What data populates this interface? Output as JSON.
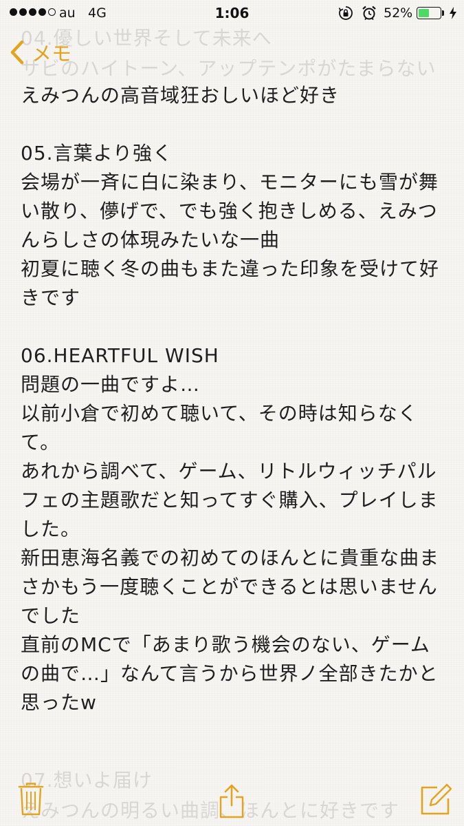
{
  "status_bar": {
    "carrier": "au",
    "network": "4G",
    "time": "1:06",
    "battery_percent": "52%",
    "battery_level": 0.52,
    "signal_bars_filled": 4,
    "signal_bars_total": 5,
    "icons": [
      "rotation-lock-icon",
      "alarm-icon",
      "charging-bolt-icon"
    ]
  },
  "nav": {
    "back_label": "メモ"
  },
  "ghost_lines": [
    "04.優しい世界そして未来へ",
    "サビのハイトーン、アップテンポがたまらない",
    "07.想いよ届け",
    "えみつんの明るい曲調、ほんとに好きです"
  ],
  "note": {
    "lines": [
      "えみつんの高音域狂おしいほど好き",
      "",
      "05.言葉より強く",
      "会場が一斉に白に染まり、モニターにも雪が舞",
      "い散り、儚げで、でも強く抱きしめる、えみつ",
      "んらしさの体現みたいな一曲",
      "初夏に聴く冬の曲もまた違った印象を受けて好",
      "きです",
      "",
      "06.HEARTFUL WISH",
      "問題の一曲ですよ…",
      "以前小倉で初めて聴いて、その時は知らなく",
      "て。",
      "あれから調べて、ゲーム、リトルウィッチパル",
      "フェの主題歌だと知ってすぐ購入、プレイしま",
      "した。",
      "新田恵海名義での初めてのほんとに貴重な曲ま",
      "さかもう一度聴くことができるとは思いません",
      "でした",
      "直前のMCで「あまり歌う機会のない、ゲーム",
      "の曲で…」なんて言うから世界ノ全部きたかと",
      "思ったw"
    ]
  },
  "toolbar": {
    "items": [
      "trash-icon",
      "share-icon",
      "compose-icon"
    ]
  },
  "colors": {
    "accent": "#e2a41e",
    "battery_fill": "#4cd964",
    "background": "#f6f5f2",
    "text": "#1e1e1e"
  }
}
